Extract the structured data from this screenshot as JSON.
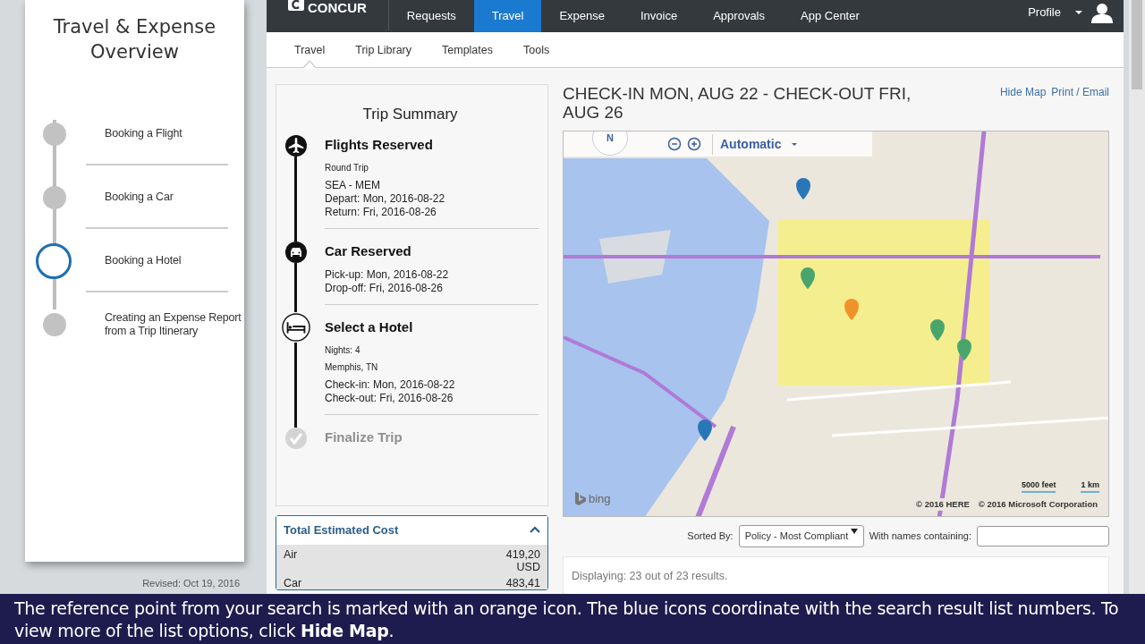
{
  "sidebar": {
    "title": "Travel & Expense Overview",
    "steps": [
      {
        "label": "Booking a Flight",
        "selected": false
      },
      {
        "label": "Booking a Car",
        "selected": false
      },
      {
        "label": "Booking a Hotel",
        "selected": true
      },
      {
        "label": "Creating an Expense Report from a Trip Itinerary",
        "selected": false
      }
    ],
    "revised": "Revised: Oct 19, 2016"
  },
  "topnav": {
    "logo": "CONCUR",
    "items": [
      {
        "label": "Requests",
        "selected": false
      },
      {
        "label": "Travel",
        "selected": true
      },
      {
        "label": "Expense",
        "selected": false
      },
      {
        "label": "Invoice",
        "selected": false
      },
      {
        "label": "Approvals",
        "selected": false
      },
      {
        "label": "App Center",
        "selected": false
      }
    ],
    "profile": "Profile"
  },
  "subtabs": [
    {
      "label": "Travel",
      "selected": true
    },
    {
      "label": "Trip Library",
      "selected": false
    },
    {
      "label": "Templates",
      "selected": false
    },
    {
      "label": "Tools",
      "selected": false
    }
  ],
  "trip_summary": {
    "title": "Trip Summary",
    "sections": [
      {
        "kind": "flight",
        "title": "Flights Reserved",
        "disabled": false,
        "notes": [
          "Round Trip"
        ],
        "lines": [
          "SEA - MEM",
          "Depart: Mon, 2016-08-22",
          "Return: Fri, 2016-08-26"
        ]
      },
      {
        "kind": "car",
        "title": "Car Reserved",
        "disabled": false,
        "lines": [
          "Pick-up: Mon, 2016-08-22",
          "Drop-off: Fri, 2016-08-26"
        ]
      },
      {
        "kind": "hotel",
        "title": "Select a Hotel",
        "disabled": false,
        "notes": [
          "Nights: 4",
          "Memphis, TN"
        ],
        "lines": [
          "Check-in: Mon, 2016-08-22",
          "Check-out: Fri, 2016-08-26"
        ]
      },
      {
        "kind": "finalize",
        "title": "Finalize Trip",
        "disabled": true
      }
    ]
  },
  "cost": {
    "title": "Total Estimated Cost",
    "expanded": true,
    "rows": [
      {
        "label": "Air",
        "amount": "419,20",
        "currency": "USD"
      },
      {
        "label": "Car",
        "amount": "483,41"
      }
    ]
  },
  "results": {
    "heading": "CHECK-IN MON, AUG 22 - CHECK-OUT FRI, AUG 26",
    "links": [
      "Hide Map",
      "Print / Email"
    ],
    "map": {
      "compass": "N",
      "mode": "Automatic",
      "brand": "bing",
      "scale": [
        "5000 feet",
        "1 km"
      ],
      "credits": [
        "© 2016 HERE",
        "© 2016 Microsoft Corporation"
      ]
    },
    "sort_label": "Sorted By:",
    "sort_value": "Policy - Most Compliant",
    "filter_label": "With names containing:",
    "status": "Displaying: 23 out of 23 results."
  },
  "caption": {
    "text": "The reference point from your search is marked with an orange icon. The blue icons coordinate with the search result list numbers. To view more of the list options, click **Hide Map**."
  }
}
